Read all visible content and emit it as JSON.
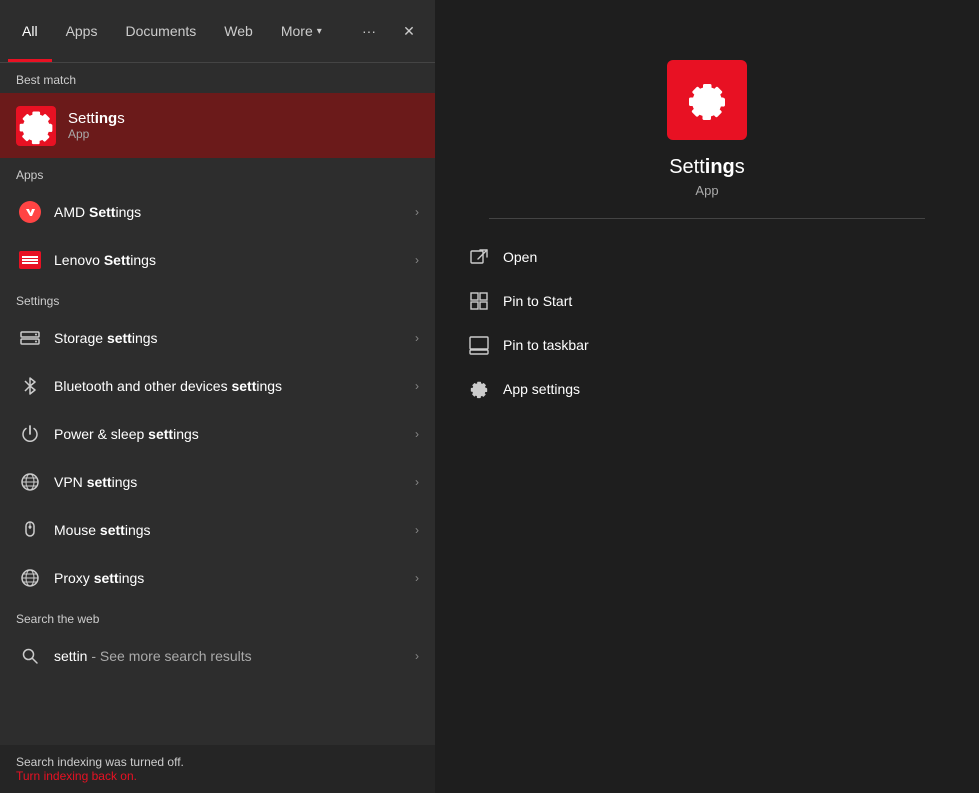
{
  "tabs": {
    "items": [
      {
        "id": "all",
        "label": "All",
        "active": true
      },
      {
        "id": "apps",
        "label": "Apps",
        "active": false
      },
      {
        "id": "documents",
        "label": "Documents",
        "active": false
      },
      {
        "id": "web",
        "label": "Web",
        "active": false
      },
      {
        "id": "more",
        "label": "More",
        "active": false
      }
    ],
    "more_chevron": "▾",
    "ellipsis": "···",
    "close": "✕"
  },
  "best_match": {
    "section_label": "Best match",
    "title_prefix": "Sett",
    "title_bold": "ing",
    "title_suffix": "s",
    "full_title": "Settings",
    "subtitle": "App"
  },
  "apps_section": {
    "label": "Apps",
    "items": [
      {
        "id": "amd",
        "text_prefix": "AMD ",
        "text_bold": "Sett",
        "text_suffix": "ings",
        "full_text": "AMD Settings"
      },
      {
        "id": "lenovo",
        "text_prefix": "Lenovo ",
        "text_bold": "Sett",
        "text_suffix": "ings",
        "full_text": "Lenovo Settings"
      }
    ]
  },
  "settings_section": {
    "label": "Settings",
    "items": [
      {
        "id": "storage",
        "text_prefix": "Storage ",
        "text_bold": "sett",
        "text_suffix": "ings",
        "full_text": "Storage settings"
      },
      {
        "id": "bluetooth",
        "text_prefix": "Bluetooth and other devices ",
        "text_bold": "sett",
        "text_suffix": "ings",
        "full_text": "Bluetooth and other devices settings"
      },
      {
        "id": "power",
        "text_prefix": "Power & sleep ",
        "text_bold": "sett",
        "text_suffix": "ings",
        "full_text": "Power & sleep settings"
      },
      {
        "id": "vpn",
        "text_prefix": "VPN ",
        "text_bold": "sett",
        "text_suffix": "ings",
        "full_text": "VPN settings"
      },
      {
        "id": "mouse",
        "text_prefix": "Mouse ",
        "text_bold": "sett",
        "text_suffix": "ings",
        "full_text": "Mouse settings"
      },
      {
        "id": "proxy",
        "text_prefix": "Proxy ",
        "text_bold": "sett",
        "text_suffix": "ings",
        "full_text": "Proxy settings"
      }
    ]
  },
  "search_web": {
    "label": "Search the web",
    "query": "settin",
    "description": " - See more search results"
  },
  "footer": {
    "index_message": "Search indexing was turned off.",
    "index_link": "Turn indexing back on."
  },
  "right_panel": {
    "app_name_prefix": "Sett",
    "app_name_bold": "ing",
    "app_name_suffix": "s",
    "full_name": "Settings",
    "app_type": "App",
    "actions": [
      {
        "id": "open",
        "label": "Open"
      },
      {
        "id": "pin-start",
        "label": "Pin to Start"
      },
      {
        "id": "pin-taskbar",
        "label": "Pin to taskbar"
      },
      {
        "id": "app-settings",
        "label": "App settings"
      }
    ]
  },
  "colors": {
    "accent": "#e81123",
    "background_left": "#2d2d2d",
    "background_right": "#1e1e1e",
    "best_match_bg": "#6b1a1a",
    "tab_active_underline": "#e81123"
  }
}
